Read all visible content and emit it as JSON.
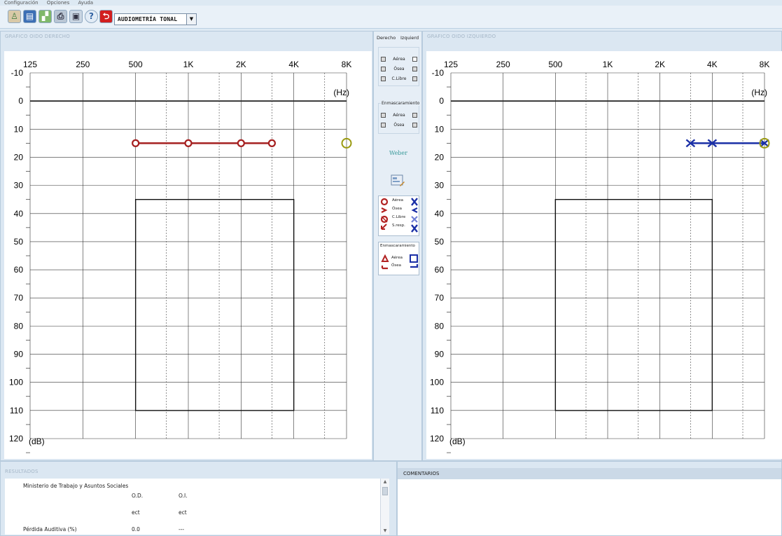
{
  "menu": [
    "Configuración",
    "Opciones",
    "Ayuda"
  ],
  "toolbar": {
    "icons": [
      "patient-icon",
      "report-icon",
      "chart-icon",
      "print-icon",
      "preview-icon",
      "help-icon",
      "exit-icon"
    ],
    "test_select": "AUDIOMETRÍA TONAL"
  },
  "right_panel_title": "GRAFICO OIDO DERECHO",
  "left_panel_title": "GRAFICO OIDO IZQUIERDO",
  "middle": {
    "derecho": "Derecho",
    "izquierdo": "Izquierd",
    "conduction_rows": [
      "Aérea",
      "Ósea",
      "C.Libre"
    ],
    "masking_title": "Enmascaramiento",
    "masking_rows": [
      "Aérea",
      "Ósea"
    ],
    "weber": "Weber",
    "legend1_labels": [
      "Aérea",
      "Ósea",
      "C.Libre",
      "S.resp."
    ],
    "legend2_title": "Enmascaramiento",
    "legend2_labels": [
      "Aérea",
      "Ósea"
    ],
    "colors": {
      "right": "#b22222",
      "left": "#1a2fa6"
    }
  },
  "results": {
    "title": "RESULTADOS",
    "org": "Ministerio de Trabajo y Asuntos Sociales",
    "col_od": "O.D.",
    "col_oi": "O.I.",
    "od_sub": "ect",
    "oi_sub": "ect",
    "loss_label": "Pérdida Auditiva (%)",
    "od_value": "0.0",
    "oi_value": "---"
  },
  "comments": {
    "title": "COMENTARIOS"
  },
  "chart_data": [
    {
      "type": "line",
      "panel": "right-ear",
      "title": "GRAFICO OIDO DERECHO",
      "x_ticks": [
        "125",
        "250",
        "500",
        "1K",
        "2K",
        "4K",
        "8K"
      ],
      "xlabel": "(Hz)",
      "ylabel": "(dB)",
      "y_ticks": [
        -10,
        0,
        10,
        20,
        30,
        40,
        50,
        60,
        70,
        80,
        90,
        100,
        110,
        120
      ],
      "ylim": [
        -10,
        120
      ],
      "y_inverted": true,
      "grid": true,
      "reference_box": {
        "x": [
          "500",
          "4K"
        ],
        "y": [
          35,
          110
        ]
      },
      "series": [
        {
          "symbol": "circle",
          "color": "#a52020",
          "x": [
            "500",
            "1K",
            "2K",
            "3K"
          ],
          "y": [
            15,
            15,
            15,
            15
          ]
        }
      ],
      "extra_points": [
        {
          "symbol": "circle",
          "color": "#9a9a10",
          "x": "8K",
          "y": 15
        }
      ]
    },
    {
      "type": "line",
      "panel": "left-ear",
      "title": "GRAFICO OIDO IZQUIERDO",
      "x_ticks": [
        "125",
        "250",
        "500",
        "1K",
        "2K",
        "4K",
        "8K"
      ],
      "xlabel": "(Hz)",
      "ylabel": "(dB)",
      "y_ticks": [
        -10,
        0,
        10,
        20,
        30,
        40,
        50,
        60,
        70,
        80,
        90,
        100,
        110,
        120
      ],
      "ylim": [
        -10,
        120
      ],
      "y_inverted": true,
      "grid": true,
      "reference_box": {
        "x": [
          "500",
          "4K"
        ],
        "y": [
          35,
          110
        ]
      },
      "series": [
        {
          "symbol": "x",
          "color": "#1a2fa6",
          "x": [
            "3K",
            "4K",
            "8K"
          ],
          "y": [
            15,
            15,
            15
          ]
        }
      ],
      "extra_points": [
        {
          "symbol": "circle",
          "color": "#9a9a10",
          "x": "8K",
          "y": 15
        }
      ]
    }
  ]
}
